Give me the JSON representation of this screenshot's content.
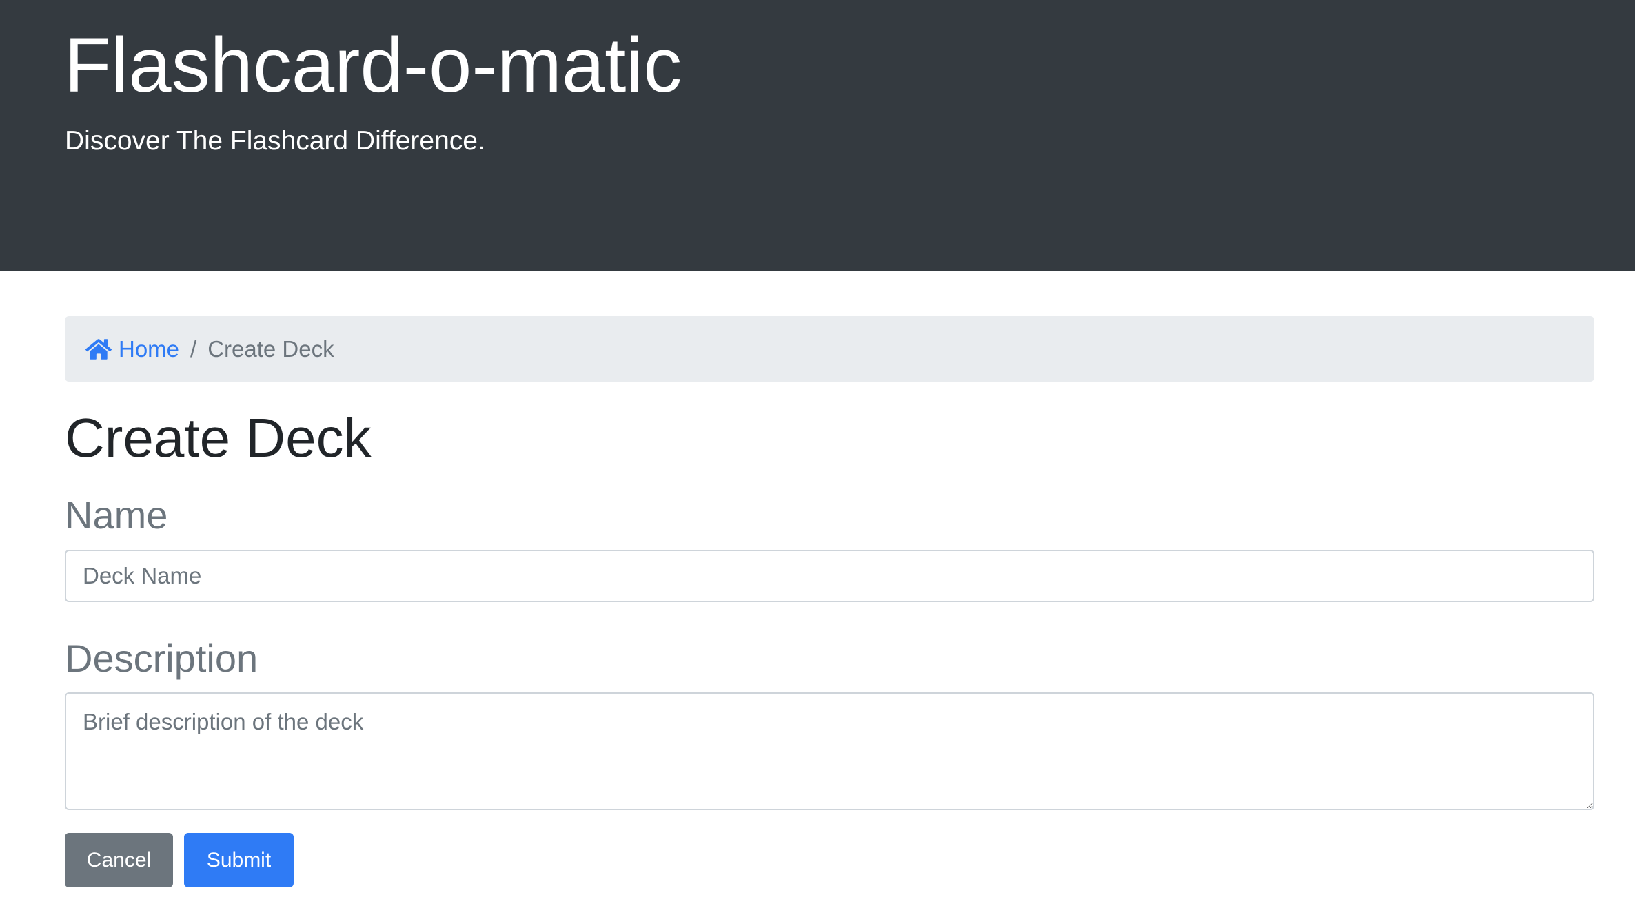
{
  "header": {
    "title": "Flashcard-o-matic",
    "tagline": "Discover The Flashcard Difference."
  },
  "breadcrumb": {
    "home_icon": "home-icon",
    "home_label": "Home",
    "separator": "/",
    "current": "Create Deck"
  },
  "page": {
    "title": "Create Deck"
  },
  "form": {
    "name_label": "Name",
    "name_placeholder": "Deck Name",
    "name_value": "",
    "description_label": "Description",
    "description_placeholder": "Brief description of the deck",
    "description_value": "",
    "cancel_label": "Cancel",
    "submit_label": "Submit"
  },
  "colors": {
    "header_bg": "#343a40",
    "primary": "#2f7bf5",
    "secondary": "#6c757d",
    "breadcrumb_bg": "#e9ecef"
  }
}
